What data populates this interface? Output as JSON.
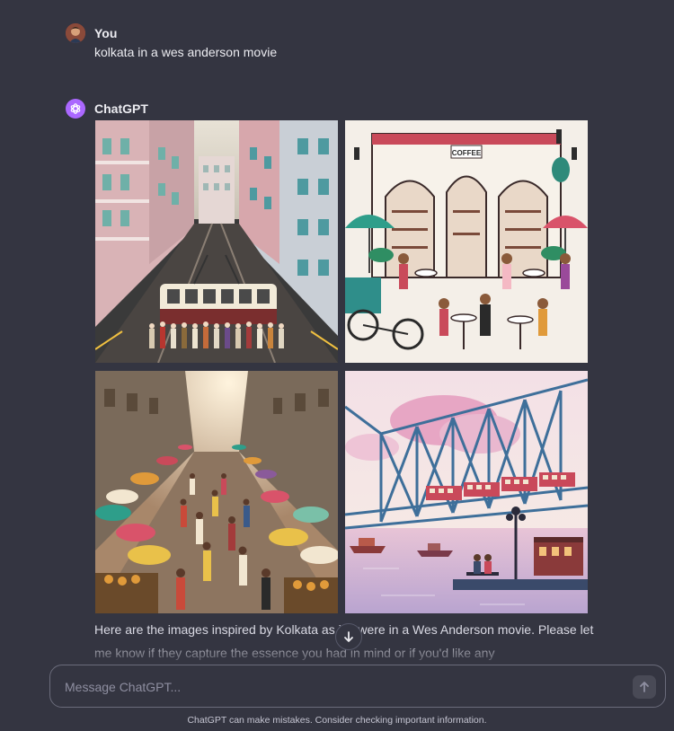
{
  "user_message": {
    "author": "You",
    "text": "kolkata in a wes anderson movie"
  },
  "assistant_message": {
    "author": "ChatGPT",
    "text": "Here are the images inspired by Kolkata as if it were in a Wes Anderson movie. Please let me know if they capture the essence you had in mind or if you'd like any",
    "images": [
      {
        "name": "kolkata-street-tram"
      },
      {
        "name": "kolkata-coffee-house"
      },
      {
        "name": "kolkata-market-umbrellas"
      },
      {
        "name": "howrah-bridge"
      }
    ],
    "cafe_sign": "COFFEE"
  },
  "composer": {
    "placeholder": "Message ChatGPT..."
  },
  "footer": {
    "disclaimer": "ChatGPT can make mistakes. Consider checking important information."
  },
  "colors": {
    "background": "#343541",
    "text": "#ececf1",
    "chatgpt_avatar": "#ab68ff"
  },
  "icons": {
    "user_avatar": "user-avatar-icon",
    "chatgpt_avatar": "openai-logo-icon",
    "scroll_down": "arrow-down-icon",
    "send": "arrow-up-icon"
  }
}
